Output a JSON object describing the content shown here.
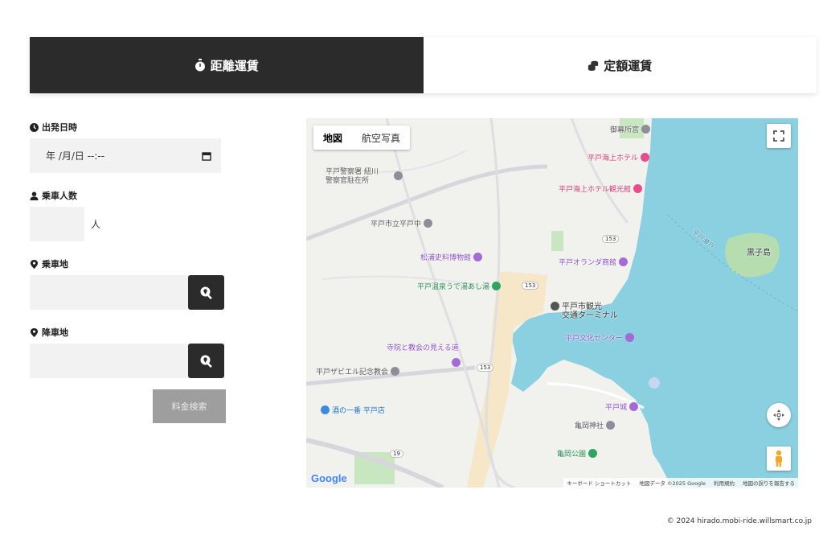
{
  "tabs": {
    "distance_label": "距離運賃",
    "fixed_label": "定額運賃"
  },
  "form": {
    "departure_label": "出発日時",
    "departure_value": "年 /月/日 --:--",
    "passengers_label": "乗車人数",
    "passengers_unit": "人",
    "pickup_label": "乗車地",
    "dropoff_label": "降車地",
    "fare_search_label": "料金検索"
  },
  "map": {
    "type_map": "地図",
    "type_satellite": "航空写真",
    "labels": {
      "goryoshosha": "御幕所宮",
      "hirado_kaijo_hotel": "平戸海上ホテル",
      "hirado_kaijo_hotel_annex": "平戸海上ホテル観光館",
      "police_1": "平戸警察署 紐川",
      "police_2": "警察官駐在所",
      "school": "平戸市立平戸中",
      "matsura_museum": "松浦史料博物館",
      "oranda_shokan": "平戸オランダ商館",
      "onsen": "平戸温泉うで湯あし湯",
      "terminal_1": "平戸市観光",
      "terminal_2": "交通ターミナル",
      "culture_center": "平戸文化センター",
      "temples": "寺院と教会の見える道",
      "xavier": "平戸ザビエル記念教会",
      "sake": "酒の一番 平戸店",
      "castle": "平戸城",
      "kameoka_shrine": "亀岡神社",
      "kameoka_park": "亀岡公園",
      "kuroko": "黒子島",
      "strait": "平戸瀬戸",
      "road_153": "153",
      "road_19": "19",
      "google": "Google",
      "footer_shortcuts": "キーボード ショートカット",
      "footer_mapdata": "地図データ ©2025 Google",
      "footer_terms": "利用規約",
      "footer_report": "地図の誤りを報告する"
    }
  },
  "footer": {
    "copyright": "© 2024 hirado.mobi-ride.willsmart.co.jp"
  },
  "colors": {
    "tab_active_bg": "#2b2b2b",
    "fare_btn_bg": "#9e9e9e",
    "sea": "#8ad0e0"
  }
}
